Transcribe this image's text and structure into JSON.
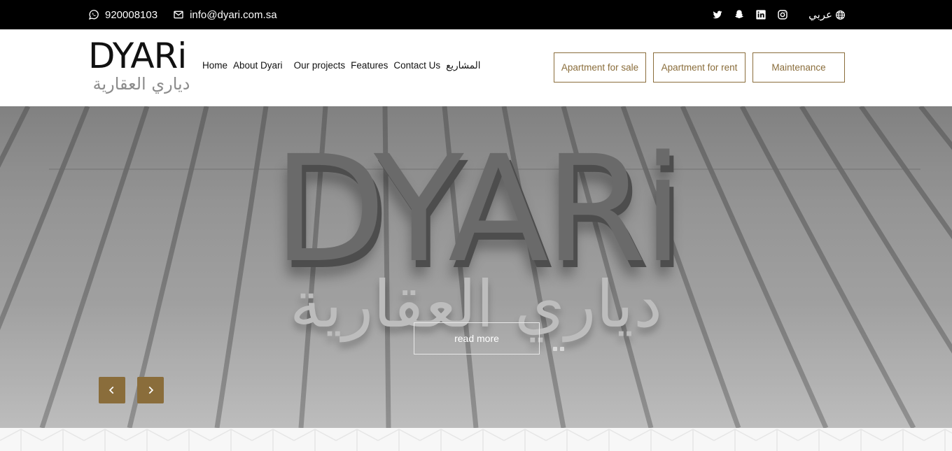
{
  "topbar": {
    "phone": "920008103",
    "email": "info@dyari.com.sa",
    "language": "عربي",
    "social_icons": [
      "twitter-icon",
      "snapchat-icon",
      "linkedin-icon",
      "instagram-icon"
    ]
  },
  "header": {
    "logo_latin": "DYARi",
    "logo_arabic": "دياري العقارية",
    "nav": [
      {
        "label": "Home"
      },
      {
        "label": "About Dyari"
      },
      {
        "label": "Our projects"
      },
      {
        "label": "Features"
      },
      {
        "label": "Contact Us"
      },
      {
        "label": "المشاريع"
      }
    ],
    "cta": {
      "sale": "Apartment for sale",
      "rent": "Apartment for rent",
      "maintenance": "Maintenance"
    }
  },
  "hero": {
    "brand_latin": "DYARi",
    "brand_arabic": "دياري العقارية",
    "read_more": "read more",
    "prev_icon": "chevron-left-icon",
    "next_icon": "chevron-right-icon"
  },
  "colors": {
    "accent": "#8a6d3b",
    "topbar_bg": "#000000",
    "white": "#ffffff"
  }
}
